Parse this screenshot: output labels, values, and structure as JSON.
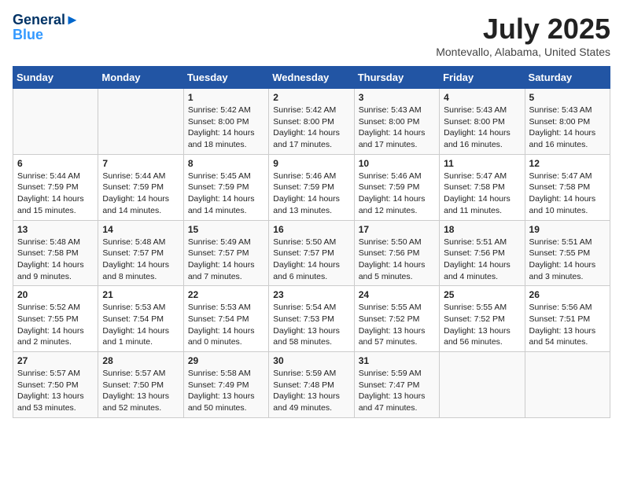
{
  "header": {
    "logo_line1": "General",
    "logo_line2": "Blue",
    "month_title": "July 2025",
    "location": "Montevallo, Alabama, United States"
  },
  "days_of_week": [
    "Sunday",
    "Monday",
    "Tuesday",
    "Wednesday",
    "Thursday",
    "Friday",
    "Saturday"
  ],
  "weeks": [
    [
      {
        "day": "",
        "info": ""
      },
      {
        "day": "",
        "info": ""
      },
      {
        "day": "1",
        "info": "Sunrise: 5:42 AM\nSunset: 8:00 PM\nDaylight: 14 hours and 18 minutes."
      },
      {
        "day": "2",
        "info": "Sunrise: 5:42 AM\nSunset: 8:00 PM\nDaylight: 14 hours and 17 minutes."
      },
      {
        "day": "3",
        "info": "Sunrise: 5:43 AM\nSunset: 8:00 PM\nDaylight: 14 hours and 17 minutes."
      },
      {
        "day": "4",
        "info": "Sunrise: 5:43 AM\nSunset: 8:00 PM\nDaylight: 14 hours and 16 minutes."
      },
      {
        "day": "5",
        "info": "Sunrise: 5:43 AM\nSunset: 8:00 PM\nDaylight: 14 hours and 16 minutes."
      }
    ],
    [
      {
        "day": "6",
        "info": "Sunrise: 5:44 AM\nSunset: 7:59 PM\nDaylight: 14 hours and 15 minutes."
      },
      {
        "day": "7",
        "info": "Sunrise: 5:44 AM\nSunset: 7:59 PM\nDaylight: 14 hours and 14 minutes."
      },
      {
        "day": "8",
        "info": "Sunrise: 5:45 AM\nSunset: 7:59 PM\nDaylight: 14 hours and 14 minutes."
      },
      {
        "day": "9",
        "info": "Sunrise: 5:46 AM\nSunset: 7:59 PM\nDaylight: 14 hours and 13 minutes."
      },
      {
        "day": "10",
        "info": "Sunrise: 5:46 AM\nSunset: 7:59 PM\nDaylight: 14 hours and 12 minutes."
      },
      {
        "day": "11",
        "info": "Sunrise: 5:47 AM\nSunset: 7:58 PM\nDaylight: 14 hours and 11 minutes."
      },
      {
        "day": "12",
        "info": "Sunrise: 5:47 AM\nSunset: 7:58 PM\nDaylight: 14 hours and 10 minutes."
      }
    ],
    [
      {
        "day": "13",
        "info": "Sunrise: 5:48 AM\nSunset: 7:58 PM\nDaylight: 14 hours and 9 minutes."
      },
      {
        "day": "14",
        "info": "Sunrise: 5:48 AM\nSunset: 7:57 PM\nDaylight: 14 hours and 8 minutes."
      },
      {
        "day": "15",
        "info": "Sunrise: 5:49 AM\nSunset: 7:57 PM\nDaylight: 14 hours and 7 minutes."
      },
      {
        "day": "16",
        "info": "Sunrise: 5:50 AM\nSunset: 7:57 PM\nDaylight: 14 hours and 6 minutes."
      },
      {
        "day": "17",
        "info": "Sunrise: 5:50 AM\nSunset: 7:56 PM\nDaylight: 14 hours and 5 minutes."
      },
      {
        "day": "18",
        "info": "Sunrise: 5:51 AM\nSunset: 7:56 PM\nDaylight: 14 hours and 4 minutes."
      },
      {
        "day": "19",
        "info": "Sunrise: 5:51 AM\nSunset: 7:55 PM\nDaylight: 14 hours and 3 minutes."
      }
    ],
    [
      {
        "day": "20",
        "info": "Sunrise: 5:52 AM\nSunset: 7:55 PM\nDaylight: 14 hours and 2 minutes."
      },
      {
        "day": "21",
        "info": "Sunrise: 5:53 AM\nSunset: 7:54 PM\nDaylight: 14 hours and 1 minute."
      },
      {
        "day": "22",
        "info": "Sunrise: 5:53 AM\nSunset: 7:54 PM\nDaylight: 14 hours and 0 minutes."
      },
      {
        "day": "23",
        "info": "Sunrise: 5:54 AM\nSunset: 7:53 PM\nDaylight: 13 hours and 58 minutes."
      },
      {
        "day": "24",
        "info": "Sunrise: 5:55 AM\nSunset: 7:52 PM\nDaylight: 13 hours and 57 minutes."
      },
      {
        "day": "25",
        "info": "Sunrise: 5:55 AM\nSunset: 7:52 PM\nDaylight: 13 hours and 56 minutes."
      },
      {
        "day": "26",
        "info": "Sunrise: 5:56 AM\nSunset: 7:51 PM\nDaylight: 13 hours and 54 minutes."
      }
    ],
    [
      {
        "day": "27",
        "info": "Sunrise: 5:57 AM\nSunset: 7:50 PM\nDaylight: 13 hours and 53 minutes."
      },
      {
        "day": "28",
        "info": "Sunrise: 5:57 AM\nSunset: 7:50 PM\nDaylight: 13 hours and 52 minutes."
      },
      {
        "day": "29",
        "info": "Sunrise: 5:58 AM\nSunset: 7:49 PM\nDaylight: 13 hours and 50 minutes."
      },
      {
        "day": "30",
        "info": "Sunrise: 5:59 AM\nSunset: 7:48 PM\nDaylight: 13 hours and 49 minutes."
      },
      {
        "day": "31",
        "info": "Sunrise: 5:59 AM\nSunset: 7:47 PM\nDaylight: 13 hours and 47 minutes."
      },
      {
        "day": "",
        "info": ""
      },
      {
        "day": "",
        "info": ""
      }
    ]
  ]
}
